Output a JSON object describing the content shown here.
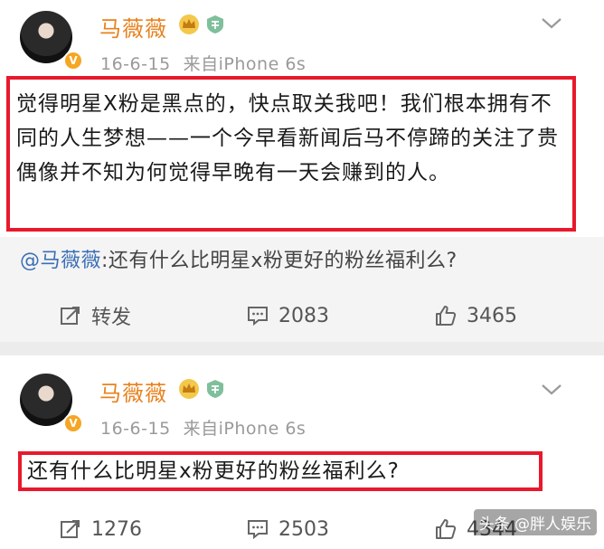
{
  "post1": {
    "author": "马薇薇",
    "date": "16-6-15",
    "source": "来自iPhone 6s",
    "text": "觉得明星X粉是黑点的，快点取关我吧！我们根本拥有不同的人生梦想——一个今早看新闻后马不停蹄的关注了贵偶像并不知为何觉得早晚有一天会赚到的人。",
    "repost_author": "@马薇薇",
    "repost_text": ":还有什么比明星x粉更好的粉丝福利么?",
    "actions": {
      "repost_label": "转发",
      "comments": "2083",
      "likes": "3465"
    }
  },
  "post2": {
    "author": "马薇薇",
    "date": "16-6-15",
    "source": "来自iPhone 6s",
    "text": "还有什么比明星x粉更好的粉丝福利么?",
    "actions": {
      "reposts": "1276",
      "comments": "2503",
      "likes": "4344"
    }
  },
  "watermark": "头条 @胖人娱乐",
  "colors": {
    "highlight_border": "#e8192c",
    "author_name": "#e8821e",
    "link": "#3b6fb6"
  }
}
